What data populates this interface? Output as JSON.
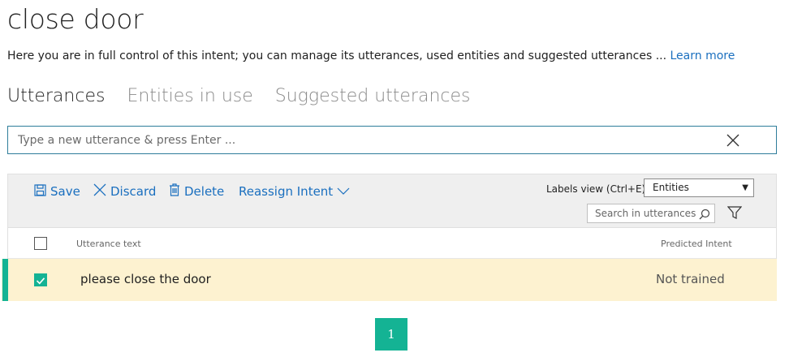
{
  "page": {
    "title": "close door",
    "description": "Here you are in full control of this intent; you can manage its utterances, used entities and suggested utterances ... ",
    "learn_more": "Learn more"
  },
  "tabs": [
    {
      "label": "Utterances",
      "active": true
    },
    {
      "label": "Entities in use",
      "active": false
    },
    {
      "label": "Suggested utterances",
      "active": false
    }
  ],
  "utterance_input": {
    "placeholder": "Type a new utterance & press Enter ...",
    "value": ""
  },
  "toolbar": {
    "save_label": "Save",
    "discard_label": "Discard",
    "delete_label": "Delete",
    "reassign_label": "Reassign Intent",
    "labels_view_label": "Labels view (Ctrl+E):",
    "labels_view_value": "Entities",
    "search_placeholder": "Search in utterances ..."
  },
  "table": {
    "columns": [
      "Utterance text",
      "Predicted Intent"
    ],
    "rows": [
      {
        "utterance": "please close the door",
        "predicted_intent": "Not trained",
        "selected": true
      }
    ]
  },
  "pagination": {
    "current_page": "1"
  },
  "colors": {
    "accent": "#14b394",
    "link": "#1a6fbf",
    "selected_row": "#fdf2d0",
    "toolbar_bg": "#efefef"
  },
  "icons": [
    "close-icon",
    "save-icon",
    "discard-icon",
    "delete-icon",
    "chevron-down-icon",
    "search-icon",
    "filter-icon",
    "checkmark-icon"
  ]
}
